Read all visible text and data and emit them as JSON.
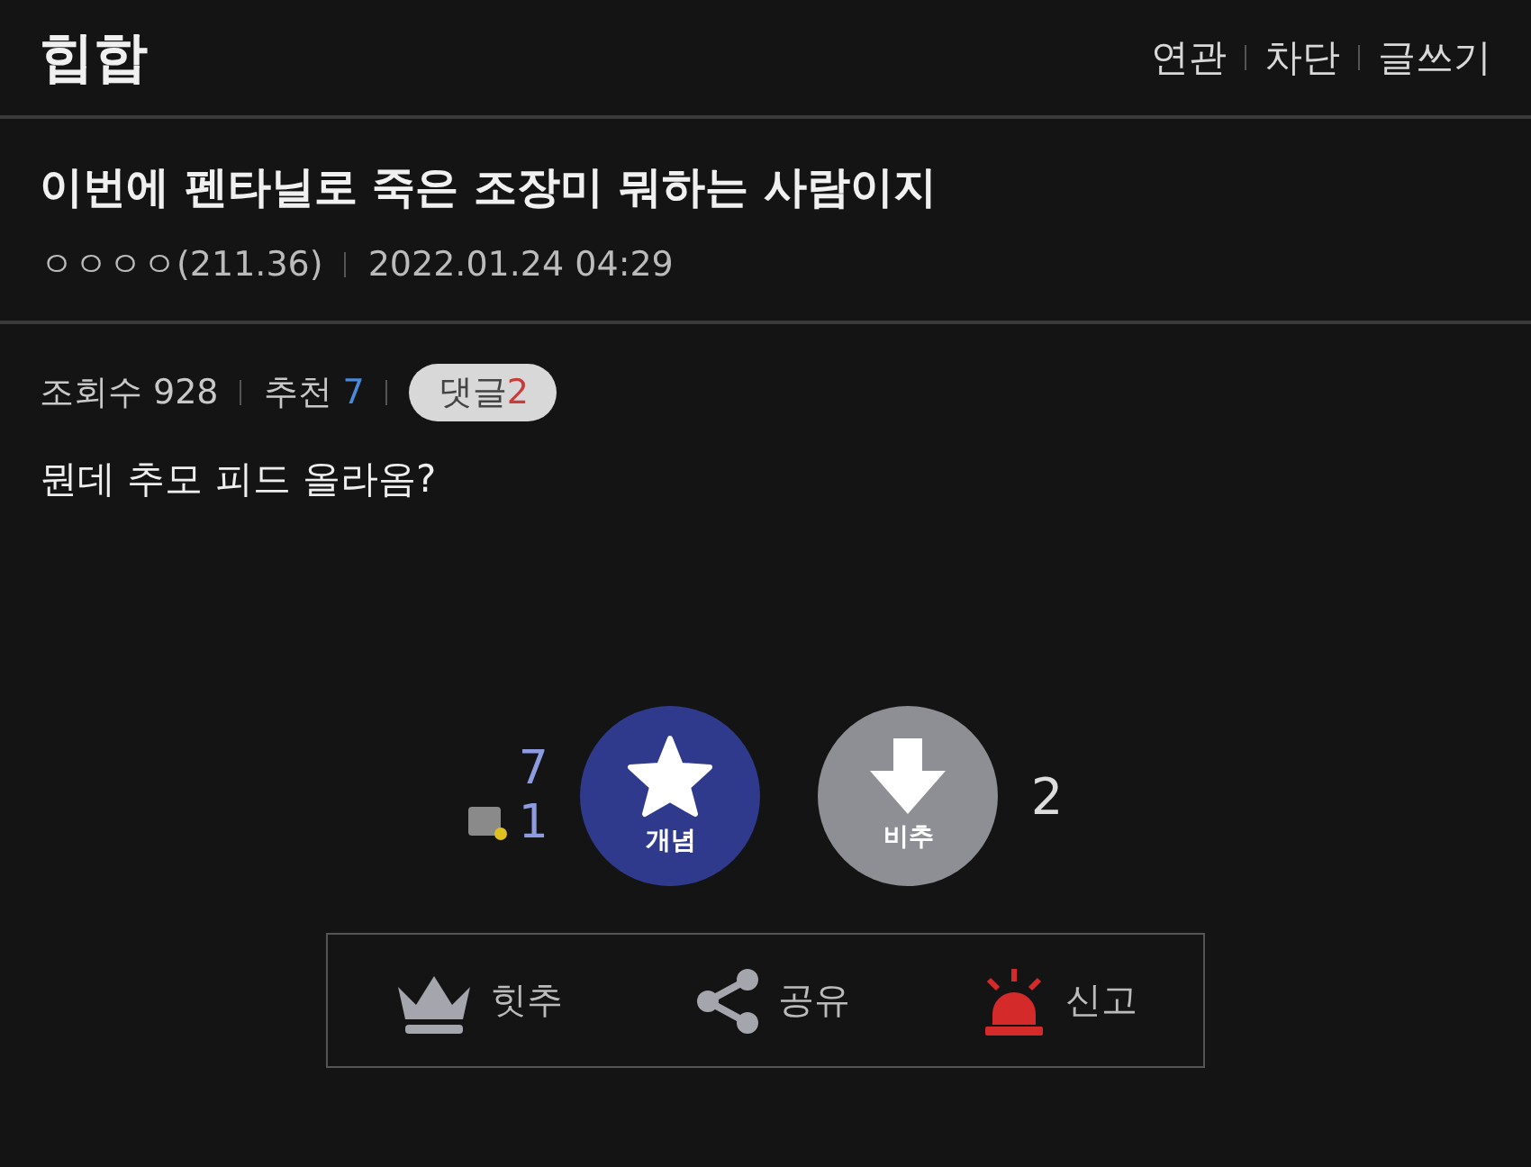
{
  "header": {
    "title": "힙합",
    "links": [
      "연관",
      "차단",
      "글쓰기"
    ]
  },
  "post": {
    "title": "이번에 펜타닐로 죽은 조장미 뭐하는 사람이지",
    "author": "ㅇㅇㅇㅇ(211.36)",
    "date": "2022.01.24 04:29",
    "stats": {
      "views_label": "조회수",
      "views": "928",
      "recommend_label": "추천",
      "recommend": "7",
      "comments_label": "댓글",
      "comments": "2"
    },
    "body": "뭔데 추모 피드 올라옴?"
  },
  "votes": {
    "up_count": "7",
    "fixed_count": "1",
    "up_label": "개념",
    "down_label": "비추",
    "down_count": "2"
  },
  "actions": [
    {
      "kind": "hit",
      "label": "힛추"
    },
    {
      "kind": "share",
      "label": "공유"
    },
    {
      "kind": "report",
      "label": "신고"
    }
  ]
}
